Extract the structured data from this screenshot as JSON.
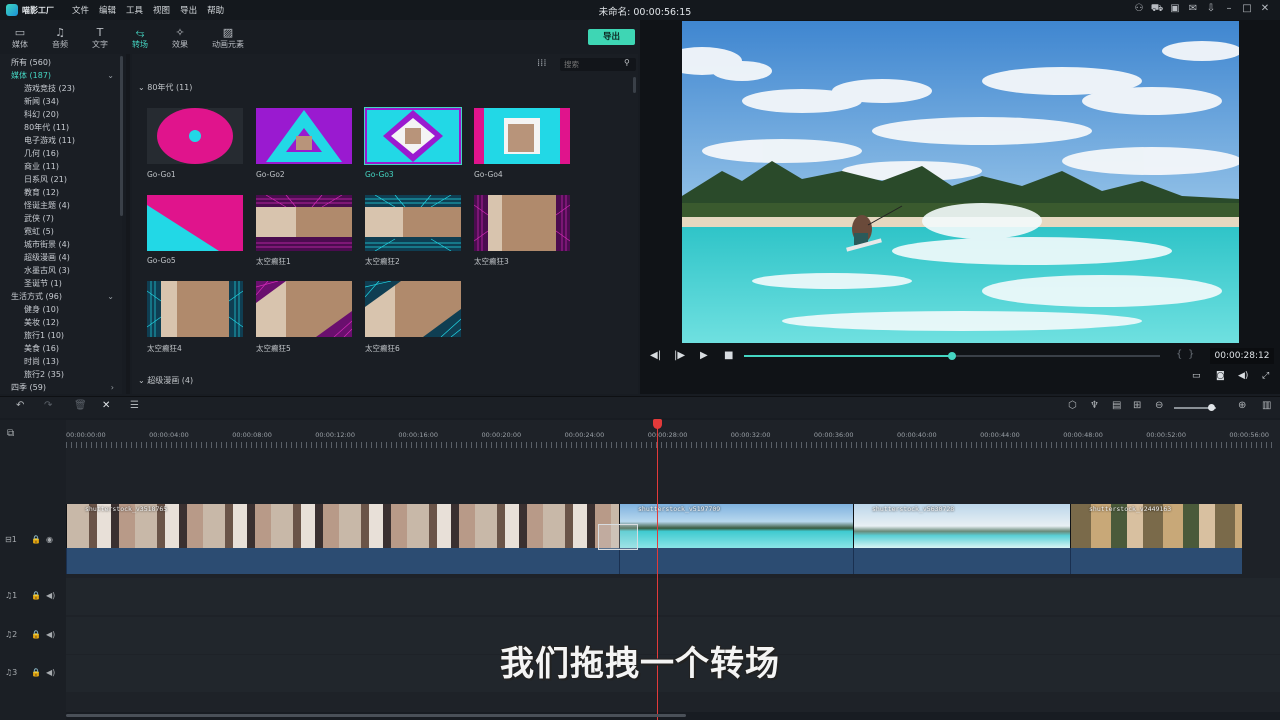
{
  "app": {
    "logo_text": "喵影工厂",
    "menu": [
      "文件",
      "编辑",
      "工具",
      "视图",
      "导出",
      "帮助"
    ],
    "title": "未命名: 00:00:56:15"
  },
  "top_tabs": [
    {
      "label": "媒体",
      "icon": "folder-icon"
    },
    {
      "label": "音频",
      "icon": "music-note-icon"
    },
    {
      "label": "文字",
      "icon": "text-icon"
    },
    {
      "label": "转场",
      "icon": "transition-icon"
    },
    {
      "label": "效果",
      "icon": "effects-icon"
    },
    {
      "label": "动画元素",
      "icon": "image-icon"
    }
  ],
  "export_label": "导出",
  "categories": [
    {
      "label": "所有 (560)",
      "level": 0
    },
    {
      "label": "媒体 (187)",
      "level": 0,
      "active": true,
      "expanded": true
    },
    {
      "label": "游戏竞技 (23)",
      "level": 1
    },
    {
      "label": "新闻 (34)",
      "level": 1
    },
    {
      "label": "科幻 (20)",
      "level": 1
    },
    {
      "label": "80年代 (11)",
      "level": 1
    },
    {
      "label": "电子游戏 (11)",
      "level": 1
    },
    {
      "label": "几何 (16)",
      "level": 1
    },
    {
      "label": "商业 (11)",
      "level": 1
    },
    {
      "label": "日系风 (21)",
      "level": 1
    },
    {
      "label": "教育 (12)",
      "level": 1
    },
    {
      "label": "怪诞主题 (4)",
      "level": 1
    },
    {
      "label": "武侠 (7)",
      "level": 1
    },
    {
      "label": "霓虹 (5)",
      "level": 1
    },
    {
      "label": "城市街景 (4)",
      "level": 1
    },
    {
      "label": "超级漫画 (4)",
      "level": 1
    },
    {
      "label": "水墨古风 (3)",
      "level": 1
    },
    {
      "label": "圣诞节 (1)",
      "level": 1
    },
    {
      "label": "生活方式 (96)",
      "level": 0,
      "expanded": true
    },
    {
      "label": "健身 (10)",
      "level": 1
    },
    {
      "label": "美妆 (12)",
      "level": 1
    },
    {
      "label": "旅行1 (10)",
      "level": 1
    },
    {
      "label": "美食 (16)",
      "level": 1
    },
    {
      "label": "时尚 (13)",
      "level": 1
    },
    {
      "label": "旅行2 (35)",
      "level": 1
    },
    {
      "label": "四季 (59)",
      "level": 0,
      "collapsed": true
    }
  ],
  "search": {
    "placeholder": "搜索"
  },
  "sections": [
    {
      "label": "80年代 (11)"
    },
    {
      "label": "超级漫画 (4)"
    }
  ],
  "transitions": [
    "Go-Go1",
    "Go-Go2",
    "Go-Go3",
    "Go-Go4",
    "Go-Go5",
    "太空癫狂1",
    "太空癫狂2",
    "太空癫狂3",
    "太空癫狂4",
    "太空癫狂5",
    "太空癫狂6"
  ],
  "selected_transition": "Go-Go3",
  "player": {
    "timecode": "00:00:28:12",
    "progress": 0.5
  },
  "ruler": [
    "00:00:00:00",
    "00:00:04:00",
    "00:00:08:00",
    "00:00:12:00",
    "00:00:16:00",
    "00:00:20:00",
    "00:00:24:00",
    "00:00:28:00",
    "00:00:32:00",
    "00:00:36:00",
    "00:00:40:00",
    "00:00:44:00",
    "00:00:48:00",
    "00:00:52:00",
    "00:00:56:00"
  ],
  "tracks": {
    "video": "1",
    "audio": [
      "1",
      "2",
      "3"
    ]
  },
  "clips": [
    {
      "label": "shutterstock_v3518765"
    },
    {
      "label": "shutterstock_v5197709"
    },
    {
      "label": "shutterstock_v5630728"
    },
    {
      "label": "shutterstock_v2449163"
    }
  ],
  "subtitle": "我们拖拽一个转场",
  "colors": {
    "accent": "#45d6c3",
    "export": "#3ed6b4",
    "playhead": "#e23a3a",
    "magenta": "#e0148c",
    "cyan": "#22d8e6",
    "purple": "#9a1ad0"
  }
}
